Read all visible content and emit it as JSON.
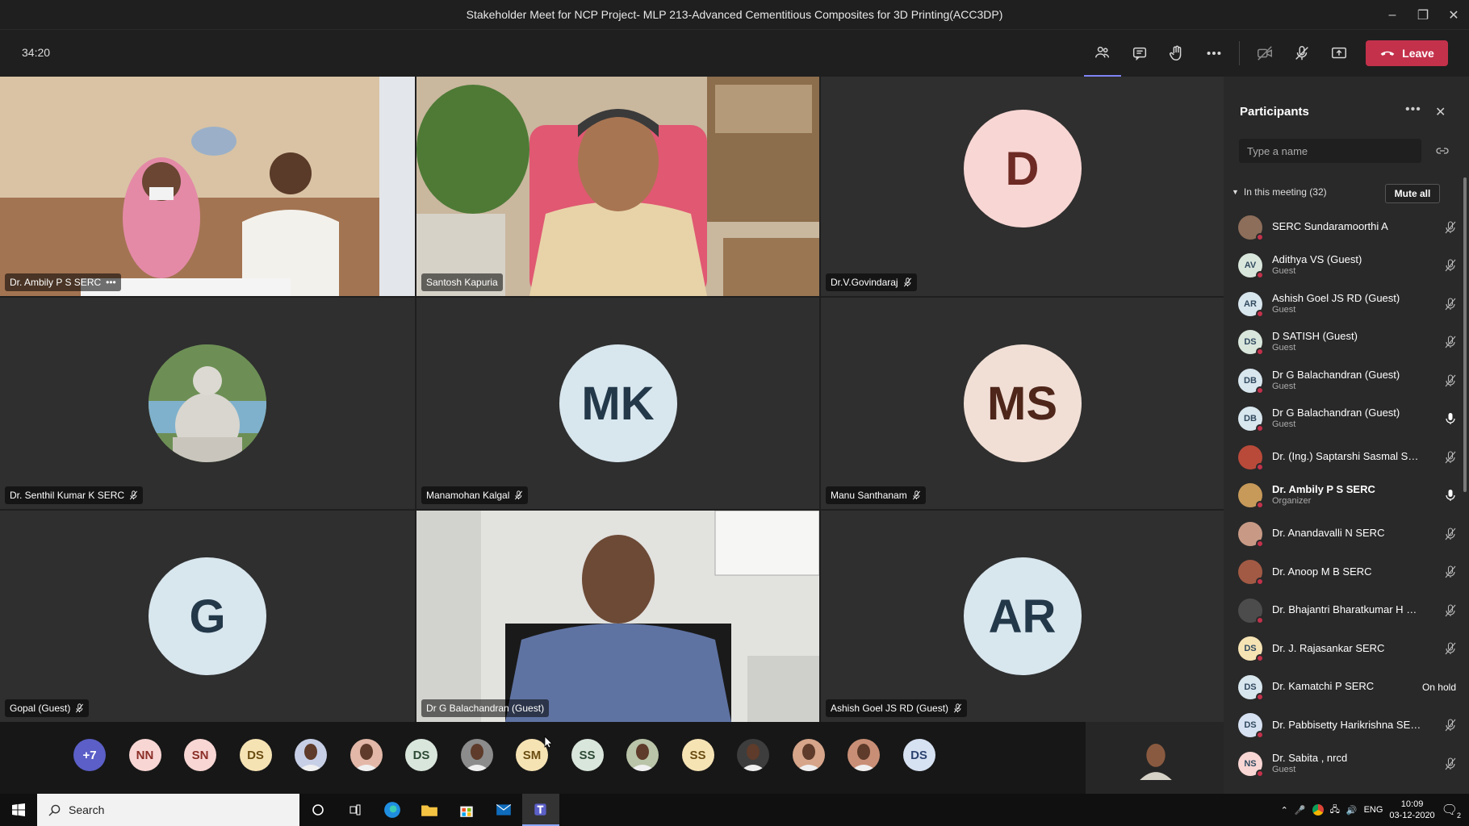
{
  "window": {
    "title": "Stakeholder Meet for NCP Project- MLP 213-Advanced Cementitious Composites for 3D Printing(ACC3DP)"
  },
  "toolbar": {
    "timer": "34:20",
    "leave_label": "Leave"
  },
  "tiles": [
    {
      "name": "Dr. Ambily P S SERC",
      "type": "video",
      "more": "•••"
    },
    {
      "name": "Santosh Kapuria",
      "type": "video"
    },
    {
      "name": "Dr.V.Govindaraj",
      "type": "avatar",
      "initials": "D",
      "color": "#f8d6d4",
      "text_color": "#6e2a24"
    },
    {
      "name": "Dr. Senthil Kumar K SERC",
      "type": "photo"
    },
    {
      "name": "Manamohan Kalgal",
      "type": "avatar",
      "initials": "MK",
      "color": "#d8e6ee",
      "text_color": "#23394a"
    },
    {
      "name": "Manu Santhanam",
      "type": "avatar",
      "initials": "MS",
      "color": "#f1dfd6",
      "text_color": "#4f261a"
    },
    {
      "name": "Gopal (Guest)",
      "type": "avatar",
      "initials": "G",
      "color": "#d8e6ee",
      "text_color": "#23394a"
    },
    {
      "name": "Dr G Balachandran (Guest)",
      "type": "video"
    },
    {
      "name": "Ashish Goel JS RD (Guest)",
      "type": "avatar",
      "initials": "AR",
      "color": "#d8e6ee",
      "text_color": "#23394a"
    }
  ],
  "strip": [
    {
      "initials": "+7",
      "color": "#5b5fc7",
      "text_color": "#ffffff"
    },
    {
      "initials": "NN",
      "color": "#f8d6d4",
      "text_color": "#8a2e26"
    },
    {
      "initials": "SN",
      "color": "#f8d6d4",
      "text_color": "#8a2e26"
    },
    {
      "initials": "DS",
      "color": "#f6e3b4",
      "text_color": "#6b4d12"
    },
    {
      "initials": "",
      "color": "#c7cfe6",
      "text_color": "#222"
    },
    {
      "initials": "",
      "color": "#e3b8a8",
      "text_color": "#222"
    },
    {
      "initials": "DS",
      "color": "#d9e6dc",
      "text_color": "#2d4a34"
    },
    {
      "initials": "",
      "color": "#8c8c8c",
      "text_color": "#222"
    },
    {
      "initials": "SM",
      "color": "#f6e3b4",
      "text_color": "#6b4d12"
    },
    {
      "initials": "SS",
      "color": "#d9e6dc",
      "text_color": "#2d4a34"
    },
    {
      "initials": "",
      "color": "#b9c4a8",
      "text_color": "#222"
    },
    {
      "initials": "SS",
      "color": "#f6e3b4",
      "text_color": "#6b4d12"
    },
    {
      "initials": "",
      "color": "#3d3d3d",
      "text_color": "#222"
    },
    {
      "initials": "",
      "color": "#d6a58a",
      "text_color": "#222"
    },
    {
      "initials": "",
      "color": "#c98f76",
      "text_color": "#222"
    },
    {
      "initials": "DS",
      "color": "#d6e1f2",
      "text_color": "#2c4470"
    }
  ],
  "panel": {
    "title": "Participants",
    "more": "•••",
    "close": "✕",
    "search_placeholder": "Type a name",
    "section_label": "In this meeting (32)",
    "mute_all": "Mute all",
    "participants": [
      {
        "name": "SERC Sundaramoorthi A",
        "sub": "",
        "initials": "",
        "avatar_color": "#8d6e5a",
        "status": "muted"
      },
      {
        "name": "Adithya VS (Guest)",
        "sub": "Guest",
        "initials": "AV",
        "avatar_color": "#d9e6dc",
        "status": "muted"
      },
      {
        "name": "Ashish Goel JS RD (Guest)",
        "sub": "Guest",
        "initials": "AR",
        "avatar_color": "#d8e6ee",
        "status": "muted"
      },
      {
        "name": "D SATISH (Guest)",
        "sub": "Guest",
        "initials": "DS",
        "avatar_color": "#d9e6dc",
        "status": "muted"
      },
      {
        "name": "Dr G Balachandran (Guest)",
        "sub": "Guest",
        "initials": "DB",
        "avatar_color": "#d8e6ee",
        "status": "muted"
      },
      {
        "name": "Dr G Balachandran (Guest)",
        "sub": "Guest",
        "initials": "DB",
        "avatar_color": "#d8e6ee",
        "status": "mic"
      },
      {
        "name": "Dr. (Ing.) Saptarshi Sasmal SE...",
        "sub": "",
        "initials": "",
        "avatar_color": "#b94a3a",
        "status": "muted"
      },
      {
        "name": "Dr. Ambily P S SERC",
        "sub": "Organizer",
        "initials": "",
        "avatar_color": "#c79a5a",
        "status": "mic",
        "bold": true
      },
      {
        "name": "Dr. Anandavalli N SERC",
        "sub": "",
        "initials": "",
        "avatar_color": "#c89a86",
        "status": "muted"
      },
      {
        "name": "Dr. Anoop M B SERC",
        "sub": "",
        "initials": "",
        "avatar_color": "#a25a44",
        "status": "muted"
      },
      {
        "name": "Dr. Bhajantri Bharatkumar H S...",
        "sub": "",
        "initials": "",
        "avatar_color": "#4c4c4c",
        "status": "muted"
      },
      {
        "name": "Dr. J. Rajasankar SERC",
        "sub": "",
        "initials": "DS",
        "avatar_color": "#f6e3b4",
        "status": "muted"
      },
      {
        "name": "Dr. Kamatchi P SERC",
        "sub": "",
        "initials": "DS",
        "avatar_color": "#d8e6ee",
        "status": "On hold"
      },
      {
        "name": "Dr. Pabbisetty Harikrishna SERC",
        "sub": "",
        "initials": "DS",
        "avatar_color": "#d6e1f2",
        "status": "muted"
      },
      {
        "name": "Dr. Sabita , nrcd",
        "sub": "Guest",
        "initials": "NS",
        "avatar_color": "#f8d6d4",
        "status": "muted"
      }
    ]
  },
  "taskbar": {
    "search_label": "Search",
    "lang": "ENG",
    "time": "10:09",
    "date": "03-12-2020",
    "notif_count": "2"
  }
}
